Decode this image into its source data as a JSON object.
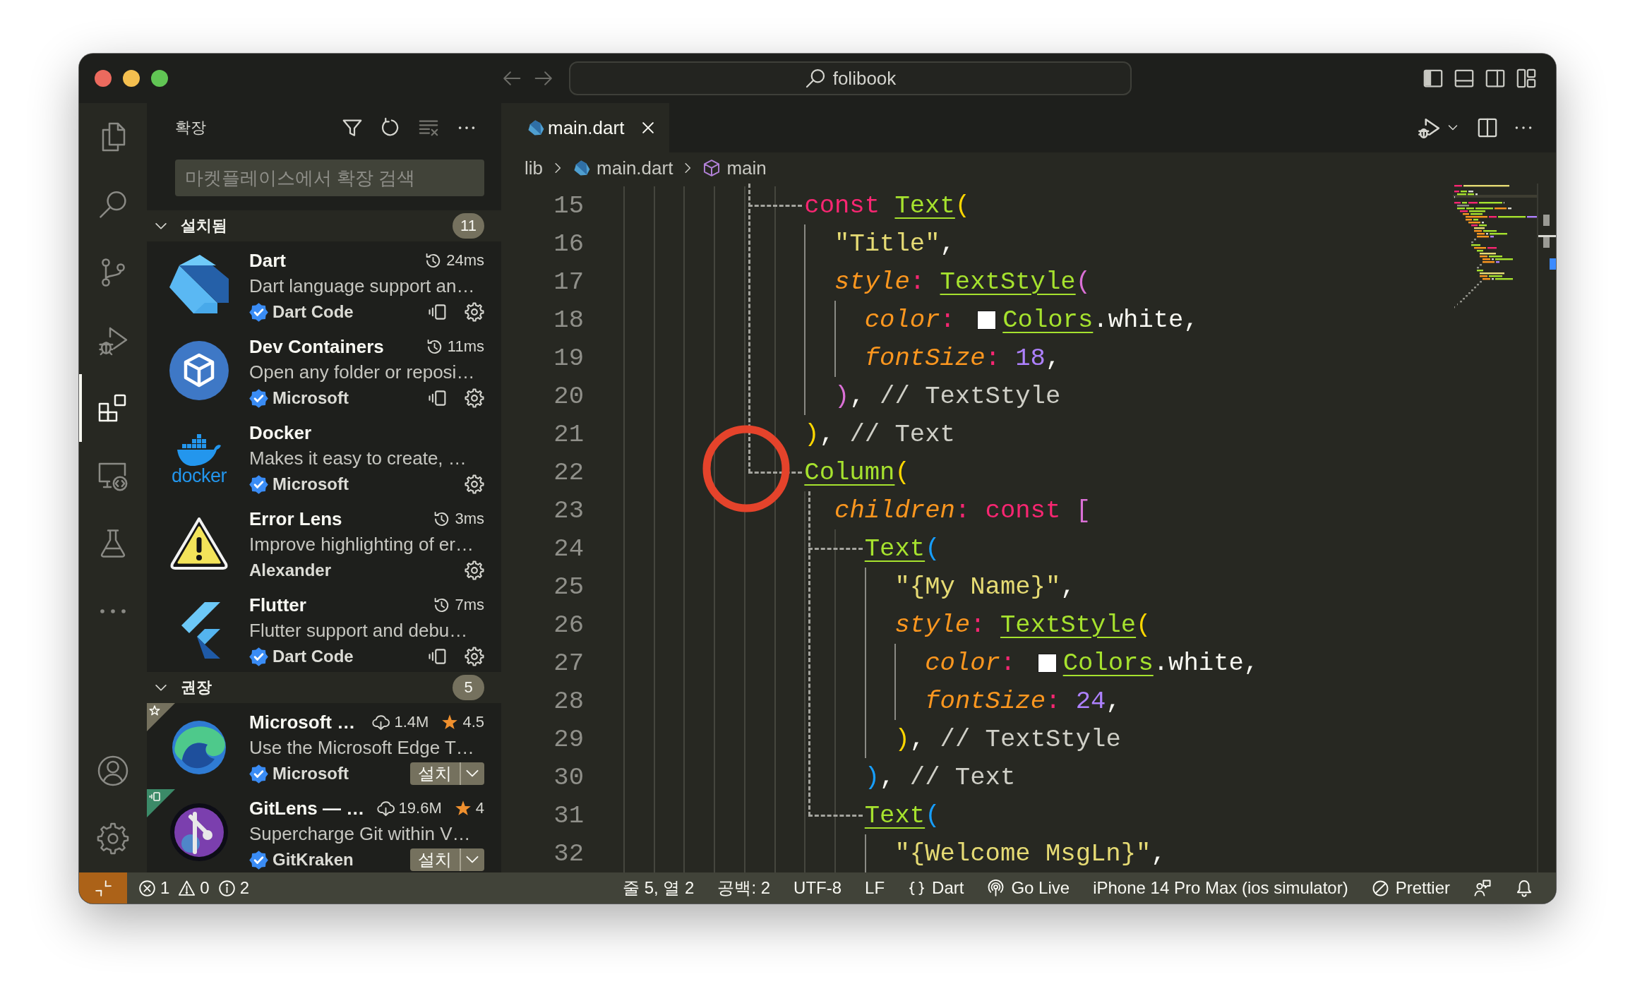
{
  "title_bar": {
    "command_center": {
      "label": "folibook"
    }
  },
  "activity_bar": {
    "items": [
      {
        "kind": "files",
        "selected": false
      },
      {
        "kind": "search",
        "selected": false
      },
      {
        "kind": "source-control",
        "selected": false
      },
      {
        "kind": "run-debug",
        "selected": false
      },
      {
        "kind": "extensions",
        "selected": true
      },
      {
        "kind": "remote-explorer",
        "selected": false
      },
      {
        "kind": "testing",
        "selected": false
      },
      {
        "kind": "more",
        "selected": false
      }
    ],
    "bottom_items": [
      {
        "kind": "account"
      },
      {
        "kind": "manage"
      }
    ]
  },
  "sidebar": {
    "title": "확장",
    "search": {
      "placeholder": "마켓플레이스에서 확장 검색"
    },
    "sections": [
      {
        "title": "설치됨",
        "count": "11",
        "expanded": true,
        "items": [
          {
            "kind": "dart",
            "name": "Dart",
            "activation_time": "24ms",
            "description": "Dart language support an…",
            "publisher": "Dart Code",
            "verified": true,
            "remote": true
          },
          {
            "kind": "containers",
            "name": "Dev Containers",
            "activation_time": "11ms",
            "description": "Open any folder or reposi…",
            "publisher": "Microsoft",
            "verified": true,
            "remote": true
          },
          {
            "kind": "docker",
            "logo_text": "docker",
            "name": "Docker",
            "description": "Makes it easy to create, …",
            "publisher": "Microsoft",
            "verified": true,
            "remote": false
          },
          {
            "kind": "warning",
            "name": "Error Lens",
            "activation_time": "3ms",
            "description": "Improve highlighting of er…",
            "publisher": "Alexander",
            "verified": false,
            "remote": false
          },
          {
            "kind": "flutter",
            "name": "Flutter",
            "activation_time": "7ms",
            "description": "Flutter support and debu…",
            "publisher": "Dart Code",
            "verified": true,
            "remote": true
          }
        ]
      },
      {
        "title": "권장",
        "count": "5",
        "expanded": true,
        "items": [
          {
            "kind": "edge",
            "ribbon": {
              "kind": "star",
              "color": "#75715e"
            },
            "name": "Microsoft …",
            "downloads": "1.4M",
            "rating": "4.5",
            "description": "Use the Microsoft Edge T…",
            "publisher": "Microsoft",
            "verified": true,
            "install_label": "설치"
          },
          {
            "kind": "gitlens",
            "ribbon": {
              "kind": "remote",
              "color": "#3b8a68"
            },
            "name": "GitLens — …",
            "downloads": "19.6M",
            "rating": "4",
            "description": "Supercharge Git within V…",
            "publisher": "GitKraken",
            "verified": true,
            "install_label": "설치"
          }
        ]
      }
    ]
  },
  "editor": {
    "tabs": [
      {
        "kind": "dart",
        "label": "main.dart",
        "selected": true
      }
    ],
    "breadcrumbs": [
      {
        "kind": "folder",
        "label": "lib"
      },
      {
        "kind": "dart-file",
        "label": "main.dart"
      },
      {
        "kind": "symbol",
        "label": "main"
      }
    ],
    "code_lines": [
      {
        "number": "15",
        "tokens": [
          {
            "kind": "keyword",
            "text": "const "
          },
          {
            "kind": "class",
            "text": "Text"
          },
          {
            "kind": "bracket-1",
            "text": "("
          }
        ],
        "children": [
          {
            "number": "16",
            "tokens": [
              {
                "kind": "string",
                "text": "\"Title\""
              },
              {
                "kind": "plain",
                "text": ","
              }
            ]
          },
          {
            "number": "17",
            "tokens": [
              {
                "kind": "param",
                "text": "style"
              },
              {
                "kind": "operator",
                "text": ": "
              },
              {
                "kind": "class",
                "text": "TextStyle"
              },
              {
                "kind": "bracket-2",
                "text": "("
              }
            ],
            "children": [
              {
                "number": "18",
                "tokens": [
                  {
                    "kind": "param",
                    "text": "color"
                  },
                  {
                    "kind": "operator",
                    "text": ": "
                  },
                  {
                    "kind": "swatch",
                    "color": "#ffffff"
                  },
                  {
                    "kind": "class",
                    "text": "Colors"
                  },
                  {
                    "kind": "plain",
                    "text": ".white,"
                  }
                ]
              },
              {
                "number": "19",
                "tokens": [
                  {
                    "kind": "param",
                    "text": "fontSize"
                  },
                  {
                    "kind": "operator",
                    "text": ": "
                  },
                  {
                    "kind": "number",
                    "text": "18"
                  },
                  {
                    "kind": "plain",
                    "text": ","
                  }
                ]
              }
            ]
          },
          {
            "number": "20",
            "tokens": [
              {
                "kind": "bracket-2",
                "text": ")"
              },
              {
                "kind": "plain",
                "text": ", "
              },
              {
                "kind": "comment",
                "text": "// TextStyle"
              }
            ]
          }
        ]
      },
      {
        "number": "21",
        "tokens": [
          {
            "kind": "bracket-1",
            "text": ")"
          },
          {
            "kind": "plain",
            "text": ", "
          },
          {
            "kind": "comment",
            "text": "// Text"
          }
        ]
      },
      {
        "number": "22",
        "tokens": [
          {
            "kind": "class",
            "text": "Column"
          },
          {
            "kind": "bracket-1",
            "text": "("
          }
        ],
        "children": [
          {
            "number": "23",
            "tokens": [
              {
                "kind": "param",
                "text": "children"
              },
              {
                "kind": "operator",
                "text": ": "
              },
              {
                "kind": "keyword",
                "text": "const "
              },
              {
                "kind": "bracket-2",
                "text": "["
              }
            ],
            "children": [
              {
                "number": "24",
                "tokens": [
                  {
                    "kind": "class",
                    "text": "Text"
                  },
                  {
                    "kind": "bracket-3",
                    "text": "("
                  }
                ],
                "children": [
                  {
                    "number": "25",
                    "tokens": [
                      {
                        "kind": "string",
                        "text": "\"{My Name}\""
                      },
                      {
                        "kind": "plain",
                        "text": ","
                      }
                    ]
                  },
                  {
                    "number": "26",
                    "tokens": [
                      {
                        "kind": "param",
                        "text": "style"
                      },
                      {
                        "kind": "operator",
                        "text": ": "
                      },
                      {
                        "kind": "class",
                        "text": "TextStyle"
                      },
                      {
                        "kind": "bracket-1",
                        "text": "("
                      }
                    ],
                    "children": [
                      {
                        "number": "27",
                        "tokens": [
                          {
                            "kind": "param",
                            "text": "color"
                          },
                          {
                            "kind": "operator",
                            "text": ": "
                          },
                          {
                            "kind": "swatch",
                            "color": "#ffffff"
                          },
                          {
                            "kind": "class",
                            "text": "Colors"
                          },
                          {
                            "kind": "plain",
                            "text": ".white,"
                          }
                        ]
                      },
                      {
                        "number": "28",
                        "tokens": [
                          {
                            "kind": "param",
                            "text": "fontSize"
                          },
                          {
                            "kind": "operator",
                            "text": ": "
                          },
                          {
                            "kind": "number",
                            "text": "24"
                          },
                          {
                            "kind": "plain",
                            "text": ","
                          }
                        ]
                      }
                    ]
                  },
                  {
                    "number": "29",
                    "tokens": [
                      {
                        "kind": "bracket-1",
                        "text": ")"
                      },
                      {
                        "kind": "plain",
                        "text": ", "
                      },
                      {
                        "kind": "comment",
                        "text": "// TextStyle"
                      }
                    ]
                  }
                ]
              },
              {
                "number": "30",
                "tokens": [
                  {
                    "kind": "bracket-3",
                    "text": ")"
                  },
                  {
                    "kind": "plain",
                    "text": ", "
                  },
                  {
                    "kind": "comment",
                    "text": "// Text"
                  }
                ]
              },
              {
                "number": "31",
                "tokens": [
                  {
                    "kind": "class",
                    "text": "Text"
                  },
                  {
                    "kind": "bracket-3",
                    "text": "("
                  }
                ],
                "children": [
                  {
                    "number": "32",
                    "tokens": [
                      {
                        "kind": "string",
                        "text": "\"{Welcome MsgLn}\""
                      },
                      {
                        "kind": "plain",
                        "text": ","
                      }
                    ]
                  }
                ]
              }
            ]
          }
        ]
      }
    ]
  },
  "status_bar": {
    "problems": {
      "errors": "1",
      "warnings": "0",
      "infos": "2"
    },
    "items": [
      {
        "kind": "text",
        "label": "줄 5, 열 2"
      },
      {
        "kind": "text",
        "label": "공백: 2"
      },
      {
        "kind": "text",
        "label": "UTF-8"
      },
      {
        "kind": "text",
        "label": "LF"
      },
      {
        "kind": "language",
        "label": "Dart"
      },
      {
        "kind": "live",
        "label": "Go Live"
      },
      {
        "kind": "text",
        "label": "iPhone 14 Pro Max (ios simulator)"
      },
      {
        "kind": "formatter",
        "label": "Prettier"
      },
      {
        "kind": "feedback"
      },
      {
        "kind": "notifications"
      }
    ]
  }
}
